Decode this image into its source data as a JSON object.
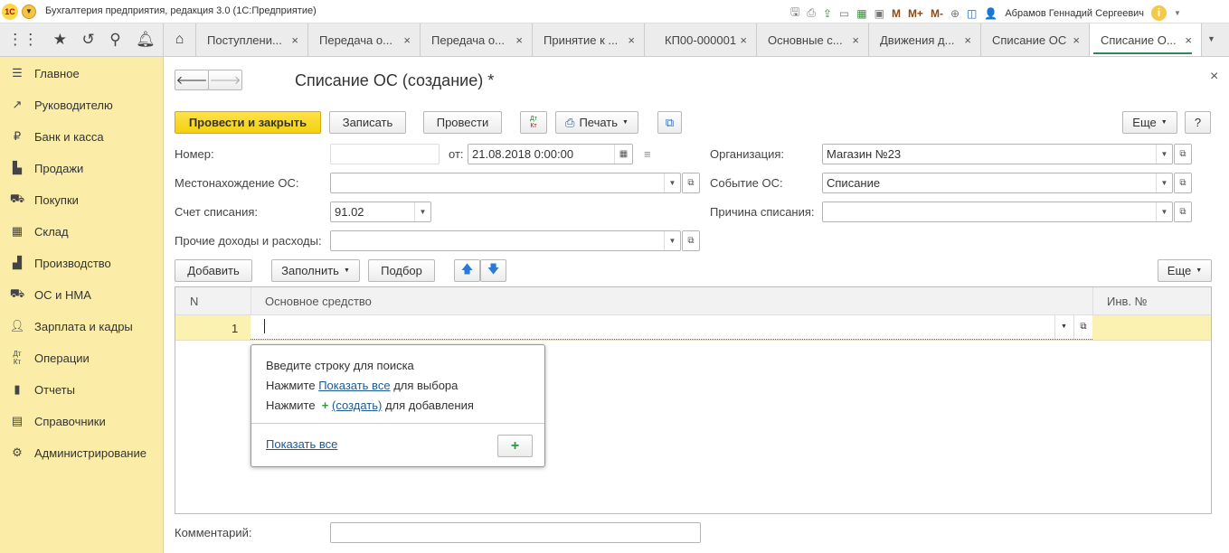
{
  "window": {
    "title": "Бухгалтерия предприятия, редакция 3.0  (1С:Предприятие)",
    "user": "Абрамов Геннадий Сергеевич",
    "m": "M",
    "mplus": "M+",
    "mminus": "M-"
  },
  "tabs": [
    "Поступлени...",
    "Передача о...",
    "Передача о...",
    "Принятие к ...",
    "КП00-000001",
    "Основные с...",
    "Движения д...",
    "Списание ОС",
    "Списание О..."
  ],
  "sidebar": [
    "Главное",
    "Руководителю",
    "Банк и касса",
    "Продажи",
    "Покупки",
    "Склад",
    "Производство",
    "ОС и НМА",
    "Зарплата и кадры",
    "Операции",
    "Отчеты",
    "Справочники",
    "Администрирование"
  ],
  "form": {
    "title": "Списание ОС (создание) *",
    "buttons": {
      "post_close": "Провести и закрыть",
      "save": "Записать",
      "post": "Провести",
      "print": "Печать",
      "more": "Еще",
      "help": "?",
      "dtkt_top": "Дт",
      "dtkt_bottom": "Кт"
    },
    "fields": {
      "number_label": "Номер:",
      "number": "",
      "date_label": "от:",
      "date": "21.08.2018  0:00:00",
      "org_label": "Организация:",
      "org": "Магазин №23",
      "location_label": "Местонахождение ОС:",
      "location": "",
      "event_label": "Событие ОС:",
      "event": "Списание",
      "account_label": "Счет списания:",
      "account": "91.02",
      "reason_label": "Причина списания:",
      "reason": "",
      "other_label": "Прочие доходы и расходы:",
      "other": "",
      "comment_label": "Комментарий:",
      "comment": ""
    }
  },
  "table": {
    "toolbar": {
      "add": "Добавить",
      "fill": "Заполнить",
      "pick": "Подбор",
      "more": "Еще"
    },
    "columns": [
      "N",
      "Основное средство",
      "Инв. №"
    ],
    "rows": [
      {
        "n": "1",
        "asset": "",
        "inv": ""
      }
    ]
  },
  "popup": {
    "line1": "Введите строку для поиска",
    "press": "Нажмите",
    "show_all": "Показать все",
    "for_select": "для выбора",
    "create": "(создать)",
    "for_add": "для добавления",
    "footer_link": "Показать все"
  }
}
